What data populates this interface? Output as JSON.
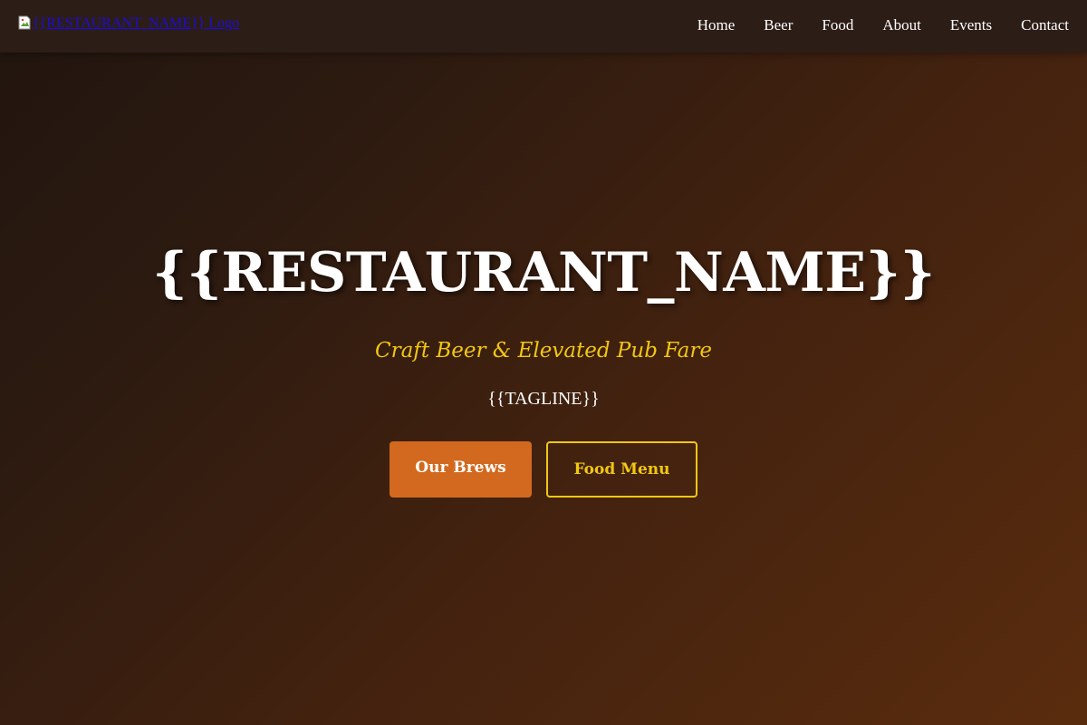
{
  "nav": {
    "logo_alt": "{{RESTAURANT_NAME}} Logo",
    "links": [
      {
        "label": "Home"
      },
      {
        "label": "Beer"
      },
      {
        "label": "Food"
      },
      {
        "label": "About"
      },
      {
        "label": "Events"
      },
      {
        "label": "Contact"
      }
    ]
  },
  "hero": {
    "title": "{{RESTAURANT_NAME}}",
    "subtitle": "Craft Beer & Elevated Pub Fare",
    "tagline": "{{TAGLINE}}",
    "primary_button": "Our Brews",
    "secondary_button": "Food Menu"
  },
  "colors": {
    "accent_orange": "#d2691e",
    "accent_gold": "#f2c811",
    "navbar_bg": "#2d1d17"
  },
  "icons": {
    "logo": "broken-image-icon"
  }
}
